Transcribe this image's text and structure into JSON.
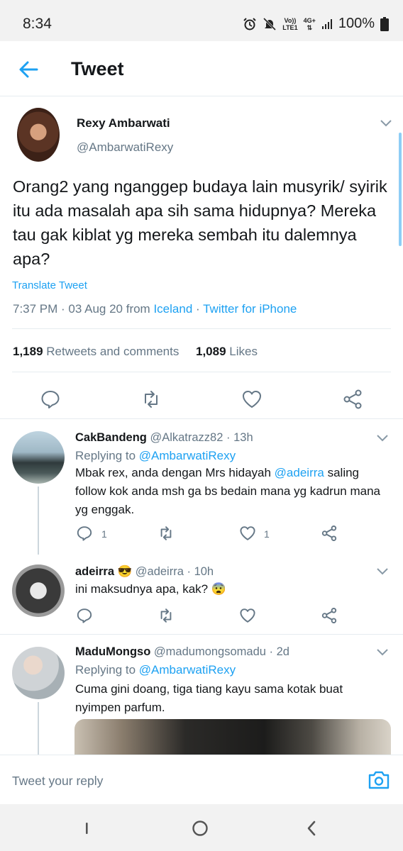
{
  "status_bar": {
    "time": "8:34",
    "net_top": "Vo))",
    "net_bottom": "LTE1",
    "net_gen": "4G+",
    "battery": "100%"
  },
  "header": {
    "title": "Tweet"
  },
  "tweet": {
    "name": "Rexy Ambarwati",
    "handle": "@AmbarwatiRexy",
    "text": "Orang2 yang nganggep budaya lain musyrik/ syirik itu ada masalah apa sih sama hidupnya? Mereka tau gak kiblat yg mereka sembah itu dalemnya apa?",
    "translate": "Translate Tweet",
    "time_date": "7:37 PM · 03 Aug 20 from ",
    "location": "Iceland",
    "separator": " · ",
    "client": "Twitter for iPhone",
    "retweets_count": "1,189",
    "retweets_label": "Retweets and comments",
    "likes_count": "1,089",
    "likes_label": "Likes"
  },
  "replies": [
    {
      "name": "CakBandeng",
      "handle": "@Alkatrazz82",
      "time": "· 13h",
      "replying_prefix": "Replying to ",
      "replying_to": "@AmbarwatiRexy",
      "text_before": "Mbak rex, anda dengan Mrs hidayah ",
      "mention": "@adeirra",
      "text_after": " saling follow kok anda msh ga bs bedain mana yg kadrun mana yg enggak.",
      "reply_count": "1",
      "like_count": "1"
    },
    {
      "name": "adeirra",
      "emoji": "😎",
      "handle": "@adeirra",
      "time": "· 10h",
      "text": "ini maksudnya apa, kak?",
      "text_emoji": "😨"
    },
    {
      "name": "MaduMongso",
      "handle": "@madumongsomadu",
      "time": "· 2d",
      "replying_prefix": "Replying to ",
      "replying_to": "@AmbarwatiRexy",
      "text": "Cuma gini doang, tiga tiang kayu sama kotak buat nyimpen parfum."
    }
  ],
  "compose": {
    "placeholder": "Tweet your reply"
  },
  "colors": {
    "accent": "#1da1f2",
    "secondary_text": "#657786",
    "divider": "#e6ecf0"
  },
  "icons": [
    "back-arrow-icon",
    "reply-icon",
    "retweet-icon",
    "like-icon",
    "share-icon",
    "camera-icon",
    "chevron-down-icon"
  ]
}
